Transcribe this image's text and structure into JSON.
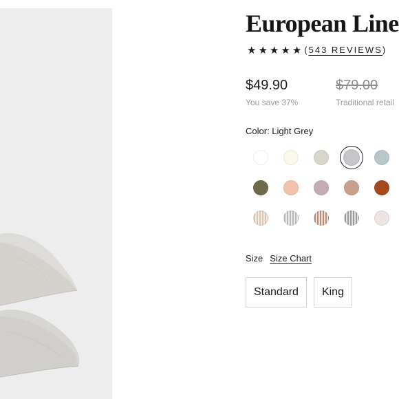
{
  "product": {
    "title": "European Linen Sheet Set",
    "rating_stars": [
      "★",
      "★",
      "★",
      "★",
      "★"
    ],
    "reviews_open": "(",
    "reviews_count": "543 REVIEWS",
    "reviews_close": ")"
  },
  "pricing": {
    "sale_price": "$49.90",
    "sale_note": "You save 37%",
    "retail_price": "$79.00",
    "retail_note": "Traditional retail"
  },
  "color": {
    "label": "Color: Light Grey",
    "selected": "Light Grey",
    "swatches": [
      [
        {
          "name": "white",
          "hex": "#ffffff"
        },
        {
          "name": "cream",
          "hex": "#fbfaea"
        },
        {
          "name": "oat",
          "hex": "#d9d6ca"
        },
        {
          "name": "light-grey",
          "hex": "#c5c6c9"
        },
        {
          "name": "blue-grey",
          "hex": "#b8c7cb"
        }
      ],
      [
        {
          "name": "olive",
          "hex": "#6f6a49"
        },
        {
          "name": "peach",
          "hex": "#f2c3a9"
        },
        {
          "name": "mauve",
          "hex": "#c7abb4"
        },
        {
          "name": "clay",
          "hex": "#c9a18c"
        },
        {
          "name": "rust",
          "hex": "#a5481d"
        }
      ],
      [
        {
          "name": "tan-stripe",
          "hex": "#d9c7b0"
        },
        {
          "name": "grey-stripe",
          "hex": "#b9babc"
        },
        {
          "name": "rust-stripe",
          "hex": "#b98c76"
        },
        {
          "name": "charcoal-stripe",
          "hex": "#9b9c9f"
        },
        {
          "name": "blush",
          "hex": "#efe4e2"
        }
      ]
    ]
  },
  "size": {
    "label": "Size",
    "chart_link": "Size Chart",
    "options": [
      "Standard",
      "King"
    ]
  }
}
